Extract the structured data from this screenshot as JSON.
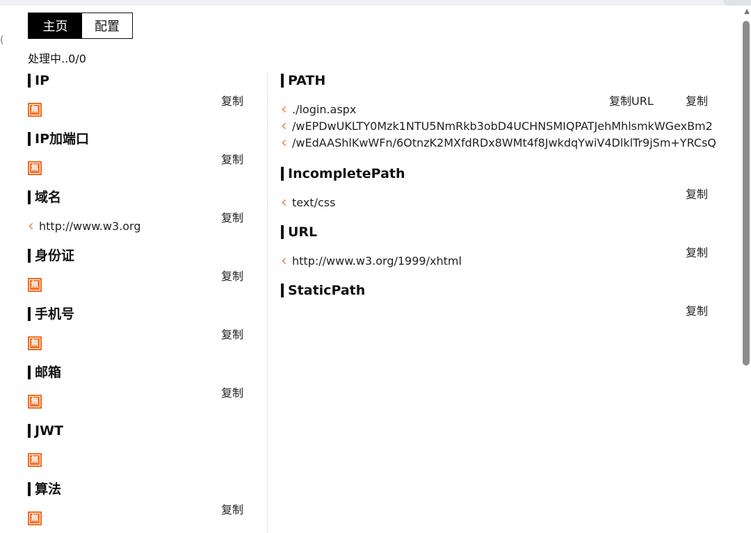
{
  "tabs": {
    "home": "主页",
    "config": "配置"
  },
  "status": "处理中..0/0",
  "copy_label": "复制",
  "copy_url_label": "复制URL",
  "empty_badge": "無",
  "left_sections": [
    {
      "title": "IP",
      "value": null
    },
    {
      "title": "IP加端口",
      "value": null
    },
    {
      "title": "域名",
      "value": "http://www.w3.org"
    },
    {
      "title": "身份证",
      "value": null
    },
    {
      "title": "手机号",
      "value": null
    },
    {
      "title": "邮箱",
      "value": null
    },
    {
      "title": "JWT",
      "value": null
    },
    {
      "title": "算法",
      "value": null
    }
  ],
  "right_sections": [
    {
      "title": "PATH",
      "values": [
        "./login.aspx",
        "/wEPDwUKLTY0Mzk1NTU5NmRkb3obD4UCHNSMIQPATJehMhlsmkWGexBm2",
        "/wEdAAShlKwWFn/6OtnzK2MXfdRDx8WMt4f8JwkdqYwiV4DlklTr9jSm+YRCsQ"
      ]
    },
    {
      "title": "IncompletePath",
      "values": [
        "text/css"
      ]
    },
    {
      "title": "URL",
      "values": [
        "http://www.w3.org/1999/xhtml"
      ]
    },
    {
      "title": "StaticPath",
      "values": []
    }
  ],
  "icons": {
    "scroll_up": "triangle-up-icon",
    "value_marker": "chevron-left-icon",
    "empty": "empty-badge-icon"
  },
  "colors": {
    "accent": "#ee6b1e",
    "chevron": "#e8834a",
    "active_tab": "#000000"
  }
}
